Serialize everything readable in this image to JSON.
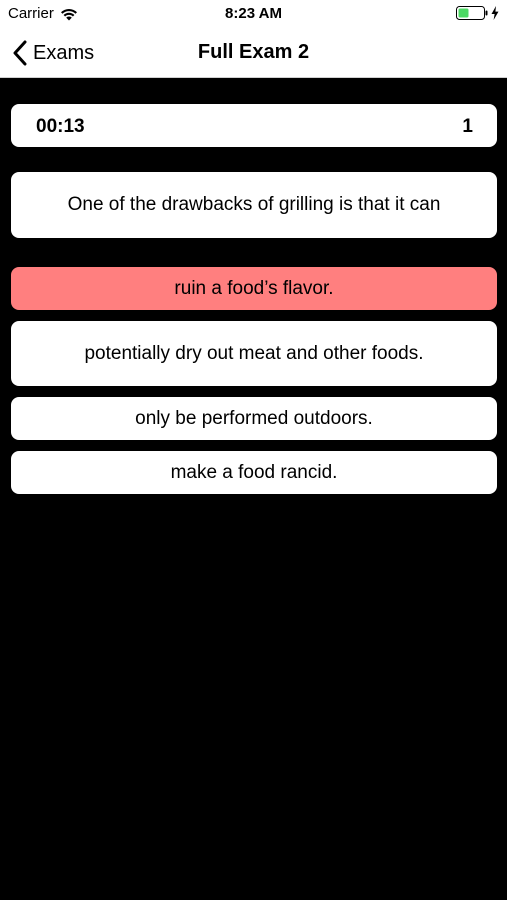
{
  "status_bar": {
    "carrier": "Carrier",
    "time": "8:23 AM"
  },
  "nav": {
    "back_label": "Exams",
    "title": "Full Exam 2"
  },
  "timer": {
    "elapsed": "00:13",
    "question_number": "1"
  },
  "question": {
    "text": "One of the drawbacks of grilling is that it can"
  },
  "answers": [
    {
      "text": "ruin a food’s flavor.",
      "state": "incorrect-selected",
      "color": "#ff7f7f"
    },
    {
      "text": "potentially dry out meat and other foods."
    },
    {
      "text": "only be performed outdoors."
    },
    {
      "text": "make a food rancid."
    }
  ],
  "colors": {
    "background": "#000000",
    "card": "#ffffff",
    "selected_wrong": "#ff7f7f",
    "battery_fill": "#4cd964"
  },
  "icons": {
    "wifi": "wifi-icon",
    "battery": "battery-icon",
    "charging": "bolt-icon",
    "back": "chevron-left-icon"
  }
}
